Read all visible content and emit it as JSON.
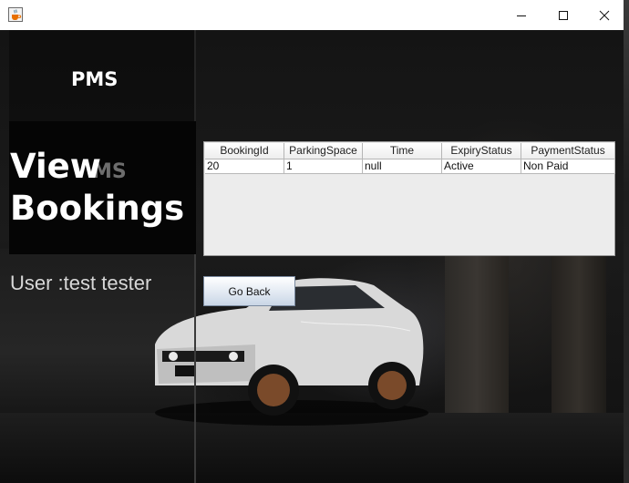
{
  "window": {
    "app_icon": "java-cup-icon",
    "controls": [
      "minimize-icon",
      "maximize-icon",
      "close-icon"
    ]
  },
  "sidebar": {
    "logo": "PMS",
    "title": "View Bookings",
    "ghost_logo": "MS",
    "user_label": "User :test tester"
  },
  "table": {
    "columns": [
      "BookingId",
      "ParkingSpace",
      "Time",
      "ExpiryStatus",
      "PaymentStatus"
    ],
    "rows": [
      [
        "20",
        "1",
        "null",
        "Active",
        "Non Paid"
      ]
    ]
  },
  "buttons": {
    "go_back": "Go Back"
  },
  "colors": {
    "button_border": "#7a8aa0",
    "table_bg": "#ececec"
  }
}
